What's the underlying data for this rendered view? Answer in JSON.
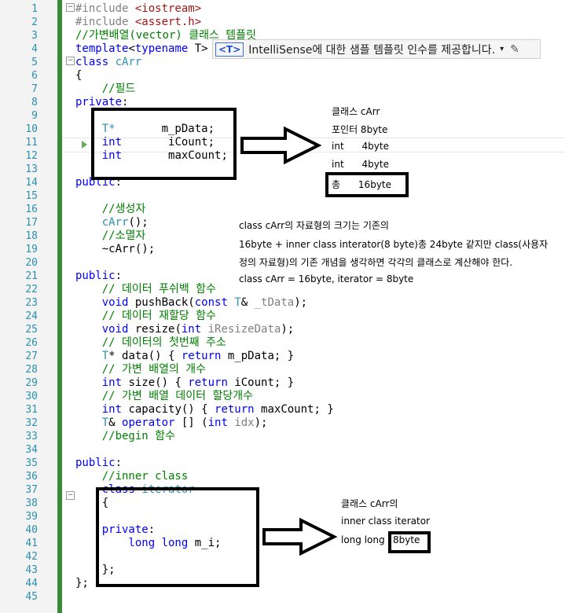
{
  "gutter_numbers": [
    "1",
    "2",
    "3",
    "4",
    "5",
    "6",
    "7",
    "8",
    "9",
    "10",
    "11",
    "12",
    "13",
    "14",
    "15",
    "16",
    "17",
    "18",
    "19",
    "20",
    "21",
    "22",
    "23",
    "24",
    "25",
    "26",
    "27",
    "28",
    "29",
    "30",
    "31",
    "32",
    "33",
    "34",
    "35",
    "36",
    "37",
    "38",
    "39",
    "40",
    "41",
    "42",
    "43",
    "44",
    "45"
  ],
  "code": {
    "l1_pp": "#include ",
    "l1_str": "<iostream>",
    "l2_pp": "#include ",
    "l2_str": "<assert.h>",
    "l3": "//가변배열(vector) 클래스 템플릿",
    "l4_kw": "template",
    "l4_rest": "<",
    "l4_kw2": "typename",
    "l4_tail": " T>",
    "l5_kw": "class ",
    "l5_ty": "cArr",
    "l6": "{",
    "l7": "    //필드",
    "l8_kw": "private",
    "l8_rest": ":",
    "l10_ty": "    T*",
    "l10_rest": "       m_pData;",
    "l11_kw": "    int",
    "l11_rest": "       iCount;",
    "l12_kw": "    int",
    "l12_rest": "       maxCount;",
    "l14_kw": "public",
    "l14_rest": ":",
    "l16": "    //생성자",
    "l17_ty": "    cArr",
    "l17_rest": "();",
    "l18": "    //소멸자",
    "l19_rest": "    ~cArr();",
    "l21_kw": "public",
    "l21_rest": ":",
    "l22": "    // 데이터 푸쉬백 함수",
    "l23_kw": "    void ",
    "l23_fn": "pushBack",
    "l23_open": "(",
    "l23_kw2": "const ",
    "l23_ty": "T",
    "l23_mid": "& ",
    "l23_param": "_tData",
    "l23_end": ");",
    "l24": "    // 데이터 재할당 함수",
    "l25_kw": "    void ",
    "l25_fn": "resize",
    "l25_open": "(",
    "l25_kw2": "int ",
    "l25_param": "iResizeData",
    "l25_end": ");",
    "l26": "    // 데이터의 첫번째 주소",
    "l27_ty": "    T",
    "l27_rest": "* data() { ",
    "l27_kw": "return ",
    "l27_tail": "m_pData; }",
    "l28": "    // 가변 배열의 개수",
    "l29_kw": "    int ",
    "l29_rest": "size() { ",
    "l29_kw2": "return ",
    "l29_tail": "iCount; }",
    "l30": "    // 가변 배열 데이터 할당개수",
    "l31_kw": "    int ",
    "l31_rest": "capacity() { ",
    "l31_kw2": "return ",
    "l31_tail": "maxCount; }",
    "l32_ty": "    T",
    "l32_rest": "& ",
    "l32_kw": "operator",
    "l32_mid": " [] (",
    "l32_kw2": "int ",
    "l32_param": "idx",
    "l32_end": ");",
    "l33_cm": "    //begin ",
    "l33_ko": "함수",
    "l35_kw": "public",
    "l35_rest": ":",
    "l36": "    //inner class",
    "l37_kw": "    class ",
    "l37_ty": "iterator",
    "l38": "    {",
    "l40_kw": "    private",
    "l40_rest": ":",
    "l41_kw": "        long long ",
    "l41_rest": "m_i;",
    "l43": "    };",
    "l44": "};"
  },
  "intellisense": {
    "badge": "<T>",
    "text": "IntelliSense에 대한 샘플 템플릿 인수를 제공합니다.",
    "caret": "▾",
    "pencil": "✎"
  },
  "notes": {
    "n1": "클래스 cArr",
    "n2": "포인터 8byte",
    "n3": "int      4byte",
    "n4": "int      4byte",
    "n5": "총      16byte",
    "m1": "class cArr의 자료형의 크기는 기존의",
    "m2": "16byte + inner class interator(8 byte)총 24byte 같지만 class(사용자",
    "m3": "정의 자료형)의 기존 개념을 생각하면 각각의 클래스로 계산해야 한다.",
    "m4": "class cArr = 16byte, iterator = 8byte",
    "b1": "클래스 cArr의",
    "b2": "inner class iterator",
    "b3": "long long ",
    "b4": "8byte"
  }
}
